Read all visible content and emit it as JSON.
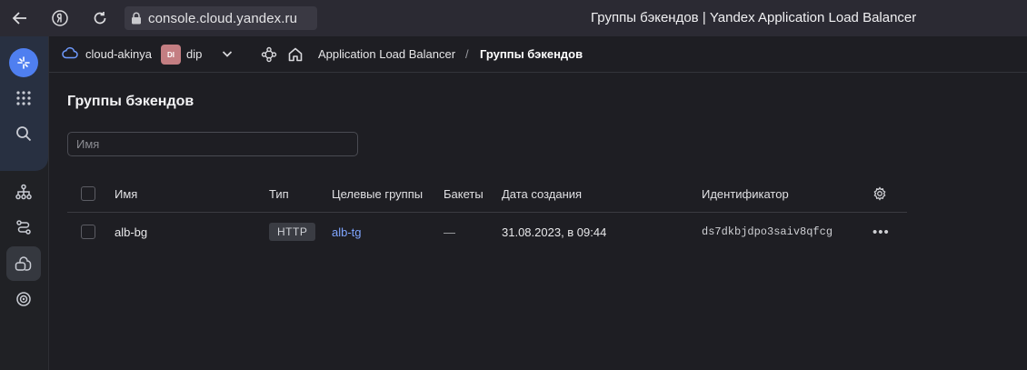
{
  "browser": {
    "url": "console.cloud.yandex.ru",
    "window_title": "Группы бэкендов | Yandex Application Load Balancer"
  },
  "nav": {
    "cloud_name": "cloud-akinya",
    "folder_badge": "DI",
    "folder_name": "dip",
    "breadcrumb_service": "Application Load Balancer",
    "breadcrumb_separator": "/",
    "breadcrumb_current": "Группы бэкендов"
  },
  "main": {
    "title": "Группы бэкендов",
    "filter_placeholder": "Имя",
    "columns": {
      "name": "Имя",
      "type": "Тип",
      "target_groups": "Целевые группы",
      "buckets": "Бакеты",
      "created": "Дата создания",
      "id": "Идентификатор"
    },
    "rows": [
      {
        "name": "alb-bg",
        "type": "HTTP",
        "target_groups": "alb-tg",
        "buckets": "—",
        "created": "31.08.2023, в 09:44",
        "id": "ds7dkbjdpo3saiv8qfcg",
        "menu": "•••"
      }
    ]
  },
  "colors": {
    "brand": "#4f7ff0",
    "link": "#7fa5ff",
    "folder_badge": "#c47e82"
  }
}
